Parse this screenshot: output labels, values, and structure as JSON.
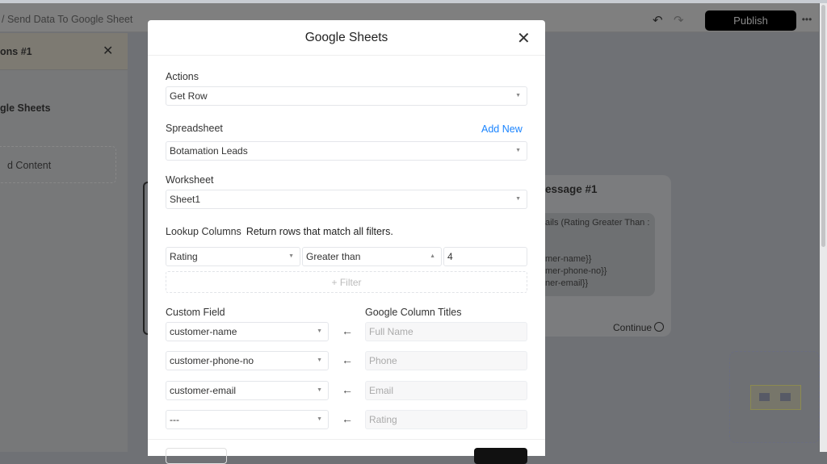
{
  "topbar": {
    "breadcrumb": "/  Send Data To Google Sheet",
    "publish": "Publish",
    "undo_icon": "undo-icon",
    "redo_icon": "redo-icon"
  },
  "left_panel": {
    "title": "ons #1",
    "subtitle": "gle Sheets",
    "content_box": "d Content"
  },
  "canvas_card": {
    "title": "essage #1",
    "lines": [
      "ails (Rating Greater Than :",
      "",
      "mer-name}}",
      "mer-phone-no}}",
      "ner-email}}"
    ],
    "continue": "Continue"
  },
  "modal": {
    "title": "Google Sheets",
    "actions": {
      "label": "Actions",
      "value": "Get Row"
    },
    "spreadsheet": {
      "label": "Spreadsheet",
      "value": "Botamation Leads",
      "add_new": "Add New"
    },
    "worksheet": {
      "label": "Worksheet",
      "value": "Sheet1"
    },
    "lookup": {
      "label": "Lookup Columns",
      "hint": "Return rows that match all filters.",
      "column": "Rating",
      "operator": "Greater than",
      "value": "4",
      "add_filter": "+ Filter"
    },
    "mapping": {
      "custom_field_label": "Custom Field",
      "column_titles_label": "Google Column Titles",
      "rows": [
        {
          "field": "customer-name",
          "column": "Full Name"
        },
        {
          "field": "customer-phone-no",
          "column": "Phone"
        },
        {
          "field": "customer-email",
          "column": "Email"
        },
        {
          "field": "---",
          "column": "Rating"
        }
      ]
    }
  }
}
